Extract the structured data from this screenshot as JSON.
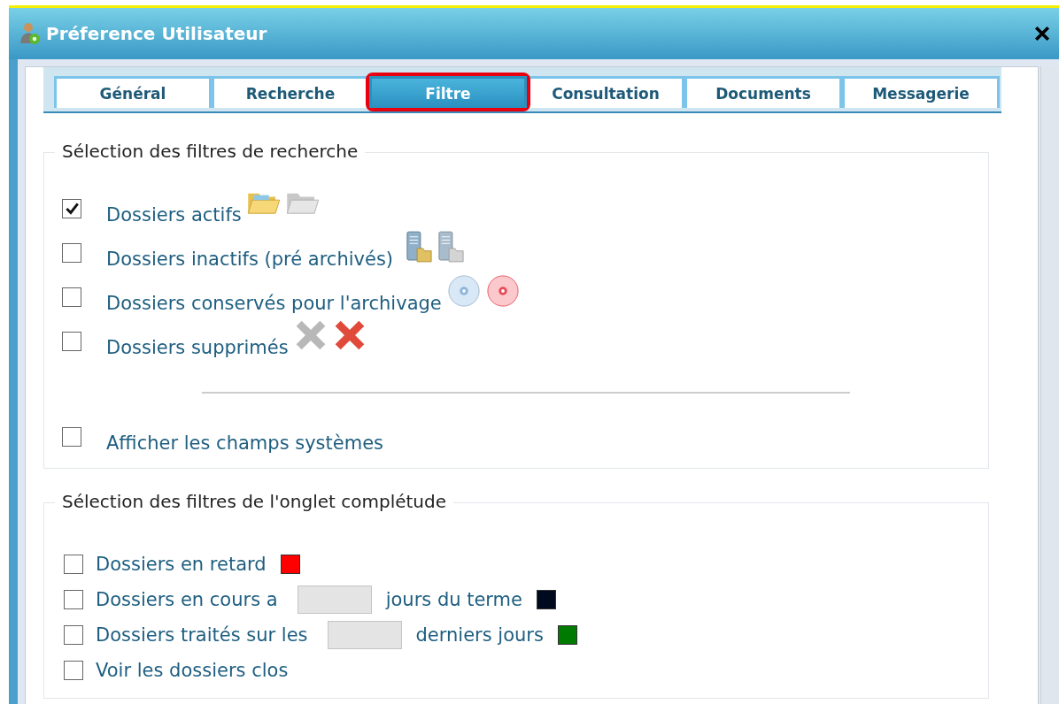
{
  "window": {
    "title": "Préference Utilisateur"
  },
  "tabs": [
    {
      "label": "Général",
      "selected": false,
      "highlighted": false
    },
    {
      "label": "Recherche",
      "selected": false,
      "highlighted": false
    },
    {
      "label": "Filtre",
      "selected": true,
      "highlighted": true
    },
    {
      "label": "Consultation",
      "selected": false,
      "highlighted": false
    },
    {
      "label": "Documents",
      "selected": false,
      "highlighted": false
    },
    {
      "label": "Messagerie",
      "selected": false,
      "highlighted": false
    }
  ],
  "search_filters": {
    "legend": "Sélection des filtres de recherche",
    "items": [
      {
        "label": "Dossiers actifs",
        "checked": true,
        "kind": "folder"
      },
      {
        "label": "Dossiers inactifs (pré archivés)",
        "checked": false,
        "kind": "server"
      },
      {
        "label": "Dossiers conservés pour l'archivage",
        "checked": false,
        "kind": "disc"
      },
      {
        "label": "Dossiers supprimés",
        "checked": false,
        "kind": "cross"
      }
    ],
    "system_fields": {
      "label": "Afficher les champs systèmes",
      "checked": false
    }
  },
  "completeness_filters": {
    "legend": "Sélection des filtres de l'onglet complétude",
    "items": [
      {
        "kind": "plain",
        "label": "Dossiers en retard",
        "checked": false,
        "color": "#ff0000"
      },
      {
        "kind": "field",
        "label": "Dossiers en cours a",
        "suffix": "jours du terme",
        "checked": false,
        "color": "#000a1e"
      },
      {
        "kind": "field",
        "label": "Dossiers traités sur les",
        "suffix": "derniers jours",
        "checked": false,
        "color": "#007a00"
      },
      {
        "kind": "plain",
        "label": "Voir les dossiers clos",
        "checked": false
      }
    ]
  }
}
